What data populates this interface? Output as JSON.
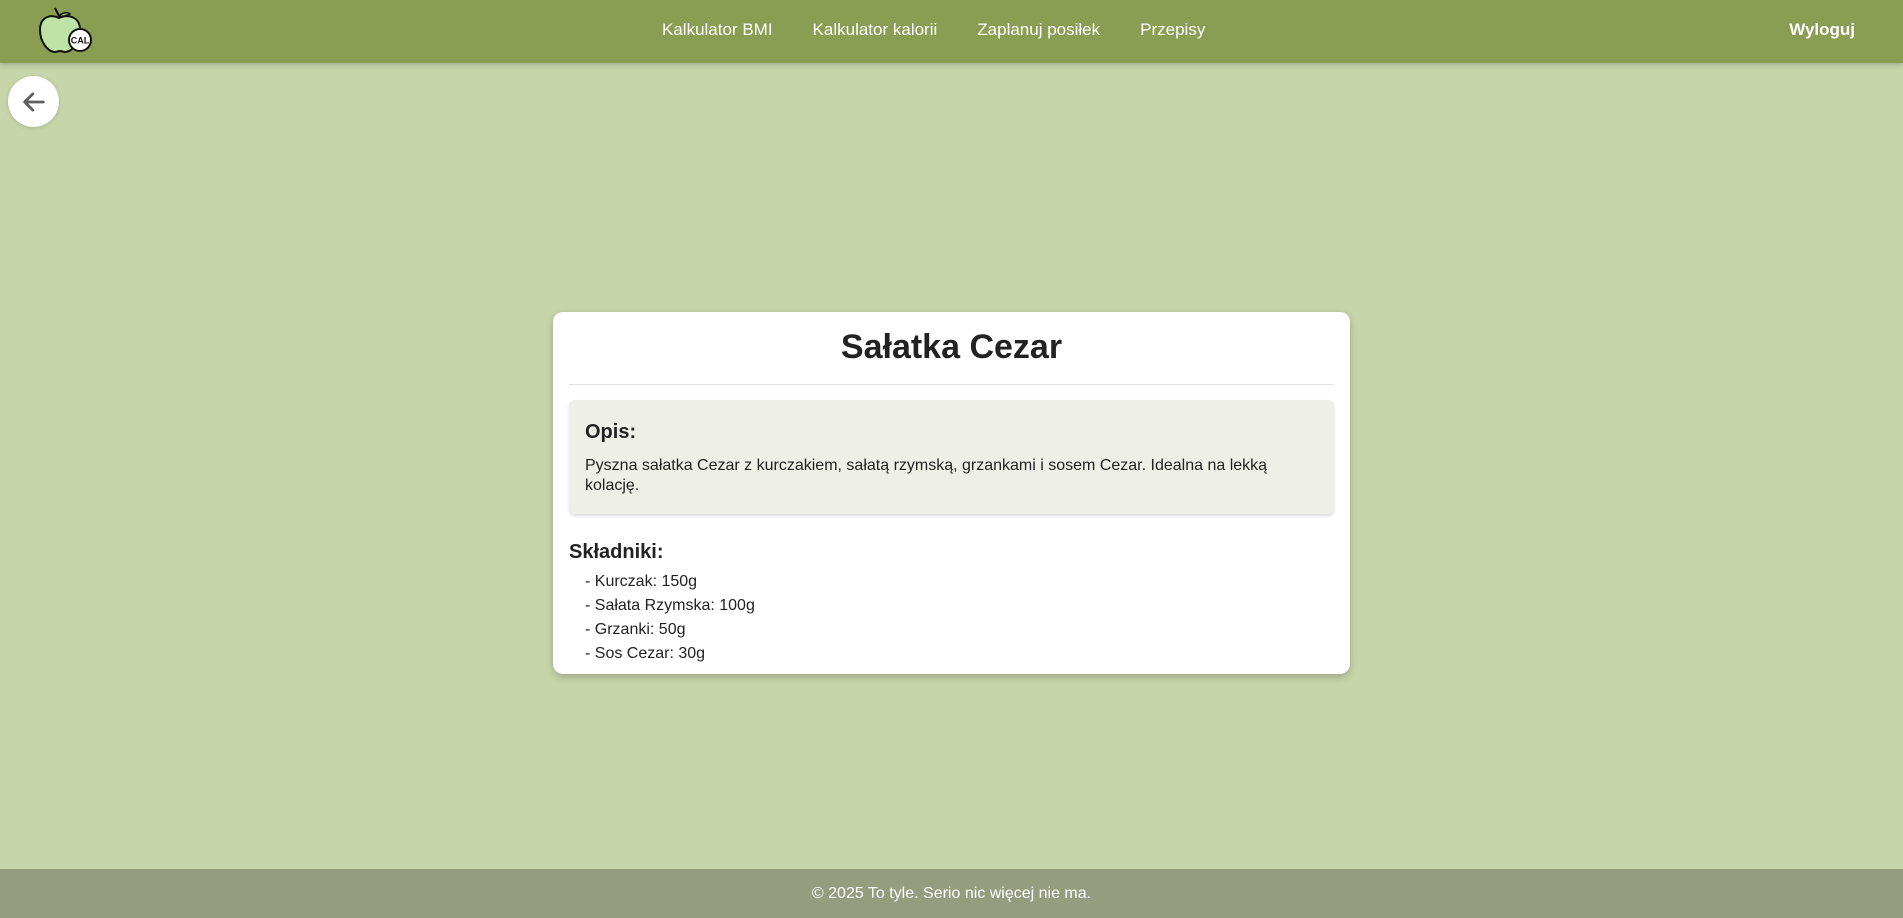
{
  "header": {
    "logo_badge": "CAL",
    "nav": [
      {
        "label": "Kalkulator BMI"
      },
      {
        "label": "Kalkulator kalorii"
      },
      {
        "label": "Zaplanuj posiłek"
      },
      {
        "label": "Przepisy"
      }
    ],
    "logout_label": "Wyloguj"
  },
  "back_button": {
    "icon": "arrow-left-icon"
  },
  "recipe": {
    "title": "Sałatka Cezar",
    "description_label": "Opis:",
    "description": "Pyszna sałatka Cezar z kurczakiem, sałatą rzymską, grzankami i sosem Cezar. Idealna na lekką kolację.",
    "ingredients_label": "Składniki:",
    "ingredients": [
      "- Kurczak: 150g",
      "- Sałata Rzymska: 100g",
      "- Grzanki: 50g",
      "- Sos Cezar: 30g"
    ]
  },
  "footer": {
    "text": "© 2025 To tyle. Serio nic więcej nie ma."
  },
  "colors": {
    "header_bg": "#899e52",
    "page_bg": "#c8d5aa",
    "footer_bg": "#949e7e",
    "description_bg": "#eef0e7"
  }
}
